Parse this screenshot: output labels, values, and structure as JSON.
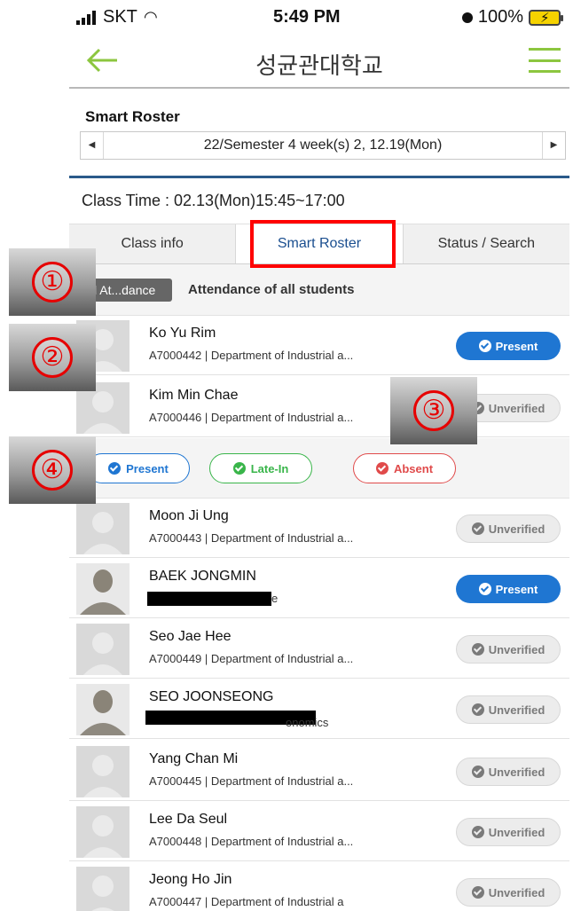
{
  "status_bar": {
    "carrier": "SKT",
    "time": "5:49 PM",
    "battery": "100%"
  },
  "header": {
    "title": "성균관대학교"
  },
  "roster": {
    "title": "Smart Roster",
    "week": "22/Semester 4 week(s) 2, 12.19(Mon)",
    "class_time": "Class Time : 02.13(Mon)15:45~17:00"
  },
  "tabs": [
    {
      "label": "Class info"
    },
    {
      "label": "Smart Roster"
    },
    {
      "label": "Status / Search"
    }
  ],
  "filter": {
    "chip": "l At...dance",
    "text": "Attendance of all students"
  },
  "students": [
    {
      "name": "Ko Yu Rim",
      "info": "A7000442 | Department of Industrial a...",
      "status": "Present"
    },
    {
      "name": "Kim Min Chae",
      "info": "A7000446 | Department of Industrial a...",
      "status": "Unverified"
    },
    {
      "name": "Moon Ji Ung",
      "info": "A7000443 | Department of Industrial a...",
      "status": "Unverified"
    },
    {
      "name": "BAEK JONGMIN",
      "info": "e",
      "status": "Present"
    },
    {
      "name": "Seo Jae Hee",
      "info": "A7000449 | Department of Industrial a...",
      "status": "Unverified"
    },
    {
      "name": "SEO JOONSEONG",
      "info": "onomics",
      "status": "Unverified"
    },
    {
      "name": "Yang Chan Mi",
      "info": "A7000445 | Department of Industrial a...",
      "status": "Unverified"
    },
    {
      "name": "Lee Da Seul",
      "info": "A7000448 | Department of Industrial a...",
      "status": "Unverified"
    },
    {
      "name": "Jeong Ho Jin",
      "info": "A7000447 | Department of Industrial a",
      "status": "Unverified"
    }
  ],
  "attendance_options": {
    "present": "Present",
    "late": "Late-In",
    "absent": "Absent"
  },
  "annotations": [
    "①",
    "②",
    "③",
    "④"
  ],
  "colors": {
    "accent_green": "#8cc63f",
    "present_blue": "#1f76d2",
    "late_green": "#39b54a",
    "absent_red": "#e04a4a",
    "annotation_red": "#e60000"
  }
}
